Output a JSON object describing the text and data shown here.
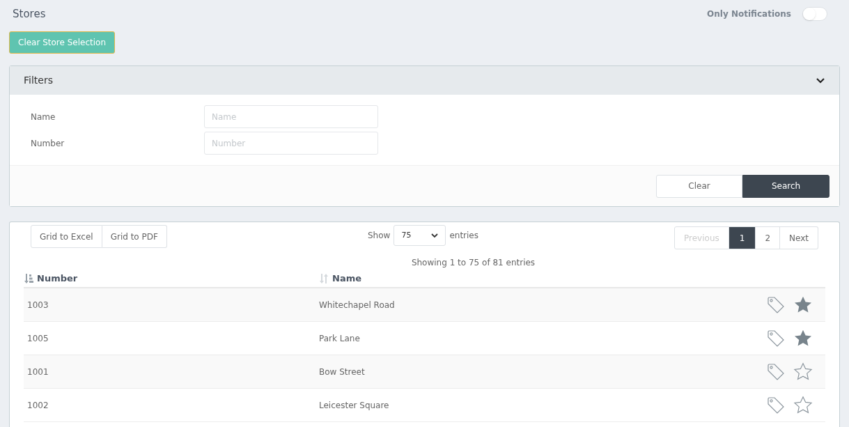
{
  "page_title": "Stores",
  "notifications_toggle": {
    "label": "Only Notifications",
    "on": false
  },
  "clear_selection_button": "Clear Store Selection",
  "filters": {
    "title": "Filters",
    "expanded": true,
    "fields": [
      {
        "label": "Name",
        "placeholder": "Name"
      },
      {
        "label": "Number",
        "placeholder": "Number"
      }
    ],
    "buttons": [
      {
        "label": "Clear",
        "kind": "secondary"
      },
      {
        "label": "Search",
        "kind": "primary"
      }
    ]
  },
  "grid": {
    "export_buttons": [
      "Grid to Excel",
      "Grid to PDF"
    ],
    "show_label": "Show",
    "page_size": "75",
    "entries_label": "entries",
    "info": "Showing 1 to 75 of 81 entries",
    "pagination": [
      {
        "label": "Previous",
        "selected": false,
        "disabled": true
      },
      {
        "label": "1",
        "selected": true,
        "disabled": false
      },
      {
        "label": "2",
        "selected": false,
        "disabled": false
      },
      {
        "label": "Next",
        "selected": false,
        "disabled": false
      }
    ],
    "columns": [
      {
        "label": "Number",
        "sorted": true
      },
      {
        "label": "Name",
        "sorted": false
      }
    ],
    "rows": [
      {
        "number": "1003",
        "name": "Whitechapel Road",
        "favorite": true
      },
      {
        "number": "1005",
        "name": "Park Lane",
        "favorite": true
      },
      {
        "number": "1001",
        "name": "Bow Street",
        "favorite": false
      },
      {
        "number": "1002",
        "name": "Leicester Square",
        "favorite": false
      }
    ]
  }
}
